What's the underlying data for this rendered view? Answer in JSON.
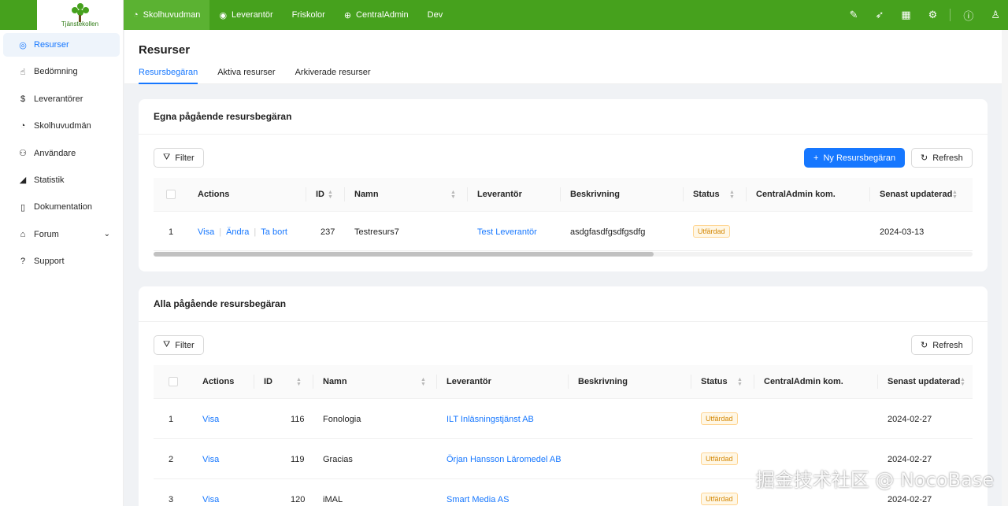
{
  "app": {
    "logo_text": "Tjänstekollen"
  },
  "topnav": [
    {
      "label": "Skolhuvudman",
      "icon": "apple-icon",
      "glyph": ""
    },
    {
      "label": "Leverantör",
      "icon": "bulb-icon",
      "glyph": ""
    },
    {
      "label": "Friskolor",
      "icon": "",
      "glyph": ""
    },
    {
      "label": "CentralAdmin",
      "icon": "globe-icon",
      "glyph": ""
    },
    {
      "label": "Dev",
      "icon": "",
      "glyph": ""
    }
  ],
  "topright_icons": [
    "highlighter-icon",
    "rocket-icon",
    "apps-icon",
    "settings-icon",
    "help-icon",
    "user-icon"
  ],
  "sidebar": {
    "items": [
      {
        "label": "Resurser",
        "icon": "bulb-icon"
      },
      {
        "label": "Bedömning",
        "icon": "thumbs-up-icon"
      },
      {
        "label": "Leverantörer",
        "icon": "dollar-circle-icon"
      },
      {
        "label": "Skolhuvudmän",
        "icon": "apple-icon"
      },
      {
        "label": "Användare",
        "icon": "users-icon"
      },
      {
        "label": "Statistik",
        "icon": "area-chart-icon"
      },
      {
        "label": "Dokumentation",
        "icon": "file-icon"
      },
      {
        "label": "Forum",
        "icon": "bank-icon"
      },
      {
        "label": "Support",
        "icon": "question-circle-icon"
      }
    ]
  },
  "page": {
    "title": "Resurser",
    "tabs": [
      "Resursbegäran",
      "Aktiva resurser",
      "Arkiverade resurser"
    ]
  },
  "own_requests": {
    "title": "Egna pågående resursbegäran",
    "filter_label": "Filter",
    "new_label": "Ny Resursbegäran",
    "refresh_label": "Refresh",
    "columns": [
      "Actions",
      "ID",
      "Namn",
      "Leverantör",
      "Beskrivning",
      "Status",
      "CentralAdmin kom.",
      "Senast updaterad"
    ],
    "rows": [
      {
        "num": "1",
        "actions": [
          "Visa",
          "Ändra",
          "Ta bort"
        ],
        "id": "237",
        "name": "Testresurs7",
        "supplier": "Test Leverantör",
        "description": "asdgfasdfgsdfgsdfg",
        "status": "Utfärdad",
        "comment": "",
        "updated": "2024-03-13"
      }
    ]
  },
  "all_requests": {
    "title": "Alla pågående resursbegäran",
    "filter_label": "Filter",
    "refresh_label": "Refresh",
    "columns": [
      "Actions",
      "ID",
      "Namn",
      "Leverantör",
      "Beskrivning",
      "Status",
      "CentralAdmin kom.",
      "Senast updaterad"
    ],
    "rows": [
      {
        "num": "1",
        "action": "Visa",
        "id": "116",
        "name": "Fonologia",
        "supplier": "ILT Inläsningstjänst AB",
        "description": "",
        "status": "Utfärdad",
        "comment": "",
        "updated": "2024-02-27"
      },
      {
        "num": "2",
        "action": "Visa",
        "id": "119",
        "name": "Gracias",
        "supplier": "Örjan Hansson Läromedel AB",
        "description": "",
        "status": "Utfärdad",
        "comment": "",
        "updated": "2024-02-27"
      },
      {
        "num": "3",
        "action": "Visa",
        "id": "120",
        "name": "iMAL",
        "supplier": "Smart Media AS",
        "description": "",
        "status": "Utfärdad",
        "comment": "",
        "updated": "2024-02-27"
      }
    ]
  },
  "watermark": "掘金技术社区 @ NocoBase"
}
